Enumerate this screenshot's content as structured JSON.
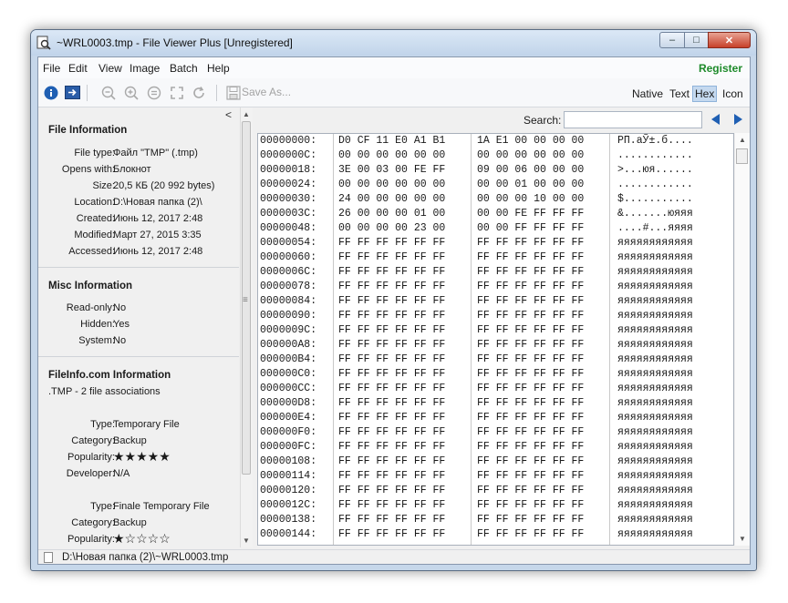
{
  "window": {
    "title": "~WRL0003.tmp - File Viewer Plus [Unregistered]",
    "min_glyph": "–",
    "max_glyph": "□",
    "close_glyph": "✕"
  },
  "menu": {
    "items": [
      "File",
      "Edit",
      "View",
      "Image",
      "Batch",
      "Help"
    ],
    "register": "Register"
  },
  "toolbar": {
    "save_as": "Save As...",
    "view_modes": [
      "Native",
      "Text",
      "Hex",
      "Icon"
    ],
    "active_view": "Hex",
    "icons": [
      "info-icon",
      "open-in-icon",
      "zoom-out-icon",
      "zoom-in-icon",
      "zoom-actual-icon",
      "fit-icon",
      "rotate-icon",
      "save-icon"
    ]
  },
  "left_panel": {
    "collapse_glyph": "<",
    "file_info": {
      "title": "File Information",
      "rows": [
        {
          "label": "File type:",
          "value": "Файл \"TMP\" (.tmp)"
        },
        {
          "label": "Opens with:",
          "value": "Блокнот"
        },
        {
          "label": "Size:",
          "value": "20,5 КБ (20 992 bytes)"
        },
        {
          "label": "Location:",
          "value": "D:\\Новая папка (2)\\"
        },
        {
          "label": "Created:",
          "value": "Июнь 12, 2017 2:48"
        },
        {
          "label": "Modified:",
          "value": "Март 27, 2015 3:35"
        },
        {
          "label": "Accessed:",
          "value": "Июнь 12, 2017 2:48"
        }
      ]
    },
    "misc_info": {
      "title": "Misc Information",
      "rows": [
        {
          "label": "Read-only:",
          "value": "No"
        },
        {
          "label": "Hidden:",
          "value": "Yes"
        },
        {
          "label": "System:",
          "value": "No"
        }
      ]
    },
    "fileinfo_com": {
      "title": "FileInfo.com Information",
      "note": ".TMP - 2 file associations",
      "assoc1": [
        {
          "label": "Type:",
          "value": "Temporary File"
        },
        {
          "label": "Category:",
          "value": "Backup"
        },
        {
          "label": "Popularity:",
          "value": "★★★★★"
        },
        {
          "label": "Developer:",
          "value": "N/A"
        }
      ],
      "assoc2": [
        {
          "label": "Type:",
          "value": "Finale Temporary File"
        },
        {
          "label": "Category:",
          "value": "Backup"
        },
        {
          "label": "Popularity:",
          "value": "★☆☆☆☆"
        }
      ]
    }
  },
  "search": {
    "label": "Search:",
    "value": ""
  },
  "hex": {
    "rows": [
      {
        "off": "00000000:",
        "h1": "D0 CF 11 E0 A1 B1",
        "h2": "1A E1 00 00 00 00",
        "asc": "РП.аЎ±.б...."
      },
      {
        "off": "0000000C:",
        "h1": "00 00 00 00 00 00",
        "h2": "00 00 00 00 00 00",
        "asc": "............"
      },
      {
        "off": "00000018:",
        "h1": "3E 00 03 00 FE FF",
        "h2": "09 00 06 00 00 00",
        "asc": ">...юя......"
      },
      {
        "off": "00000024:",
        "h1": "00 00 00 00 00 00",
        "h2": "00 00 01 00 00 00",
        "asc": "............"
      },
      {
        "off": "00000030:",
        "h1": "24 00 00 00 00 00",
        "h2": "00 00 00 10 00 00",
        "asc": "$..........."
      },
      {
        "off": "0000003C:",
        "h1": "26 00 00 00 01 00",
        "h2": "00 00 FE FF FF FF",
        "asc": "&.......юяяя"
      },
      {
        "off": "00000048:",
        "h1": "00 00 00 00 23 00",
        "h2": "00 00 FF FF FF FF",
        "asc": "....#...яяяя"
      },
      {
        "off": "00000054:",
        "h1": "FF FF FF FF FF FF",
        "h2": "FF FF FF FF FF FF",
        "asc": "яяяяяяяяяяяя"
      },
      {
        "off": "00000060:",
        "h1": "FF FF FF FF FF FF",
        "h2": "FF FF FF FF FF FF",
        "asc": "яяяяяяяяяяяя"
      },
      {
        "off": "0000006C:",
        "h1": "FF FF FF FF FF FF",
        "h2": "FF FF FF FF FF FF",
        "asc": "яяяяяяяяяяяя"
      },
      {
        "off": "00000078:",
        "h1": "FF FF FF FF FF FF",
        "h2": "FF FF FF FF FF FF",
        "asc": "яяяяяяяяяяяя"
      },
      {
        "off": "00000084:",
        "h1": "FF FF FF FF FF FF",
        "h2": "FF FF FF FF FF FF",
        "asc": "яяяяяяяяяяяя"
      },
      {
        "off": "00000090:",
        "h1": "FF FF FF FF FF FF",
        "h2": "FF FF FF FF FF FF",
        "asc": "яяяяяяяяяяяя"
      },
      {
        "off": "0000009C:",
        "h1": "FF FF FF FF FF FF",
        "h2": "FF FF FF FF FF FF",
        "asc": "яяяяяяяяяяяя"
      },
      {
        "off": "000000A8:",
        "h1": "FF FF FF FF FF FF",
        "h2": "FF FF FF FF FF FF",
        "asc": "яяяяяяяяяяяя"
      },
      {
        "off": "000000B4:",
        "h1": "FF FF FF FF FF FF",
        "h2": "FF FF FF FF FF FF",
        "asc": "яяяяяяяяяяяя"
      },
      {
        "off": "000000C0:",
        "h1": "FF FF FF FF FF FF",
        "h2": "FF FF FF FF FF FF",
        "asc": "яяяяяяяяяяяя"
      },
      {
        "off": "000000CC:",
        "h1": "FF FF FF FF FF FF",
        "h2": "FF FF FF FF FF FF",
        "asc": "яяяяяяяяяяяя"
      },
      {
        "off": "000000D8:",
        "h1": "FF FF FF FF FF FF",
        "h2": "FF FF FF FF FF FF",
        "asc": "яяяяяяяяяяяя"
      },
      {
        "off": "000000E4:",
        "h1": "FF FF FF FF FF FF",
        "h2": "FF FF FF FF FF FF",
        "asc": "яяяяяяяяяяяя"
      },
      {
        "off": "000000F0:",
        "h1": "FF FF FF FF FF FF",
        "h2": "FF FF FF FF FF FF",
        "asc": "яяяяяяяяяяяя"
      },
      {
        "off": "000000FC:",
        "h1": "FF FF FF FF FF FF",
        "h2": "FF FF FF FF FF FF",
        "asc": "яяяяяяяяяяяя"
      },
      {
        "off": "00000108:",
        "h1": "FF FF FF FF FF FF",
        "h2": "FF FF FF FF FF FF",
        "asc": "яяяяяяяяяяяя"
      },
      {
        "off": "00000114:",
        "h1": "FF FF FF FF FF FF",
        "h2": "FF FF FF FF FF FF",
        "asc": "яяяяяяяяяяяя"
      },
      {
        "off": "00000120:",
        "h1": "FF FF FF FF FF FF",
        "h2": "FF FF FF FF FF FF",
        "asc": "яяяяяяяяяяяя"
      },
      {
        "off": "0000012C:",
        "h1": "FF FF FF FF FF FF",
        "h2": "FF FF FF FF FF FF",
        "asc": "яяяяяяяяяяяя"
      },
      {
        "off": "00000138:",
        "h1": "FF FF FF FF FF FF",
        "h2": "FF FF FF FF FF FF",
        "asc": "яяяяяяяяяяяя"
      },
      {
        "off": "00000144:",
        "h1": "FF FF FF FF FF FF",
        "h2": "FF FF FF FF FF FF",
        "asc": "яяяяяяяяяяяя"
      }
    ]
  },
  "statusbar": {
    "path": "D:\\Новая папка (2)\\~WRL0003.tmp"
  },
  "colors": {
    "register": "#1d8a2a",
    "accent": "#1f5fb3",
    "hex_active": "#c5d9ef"
  }
}
